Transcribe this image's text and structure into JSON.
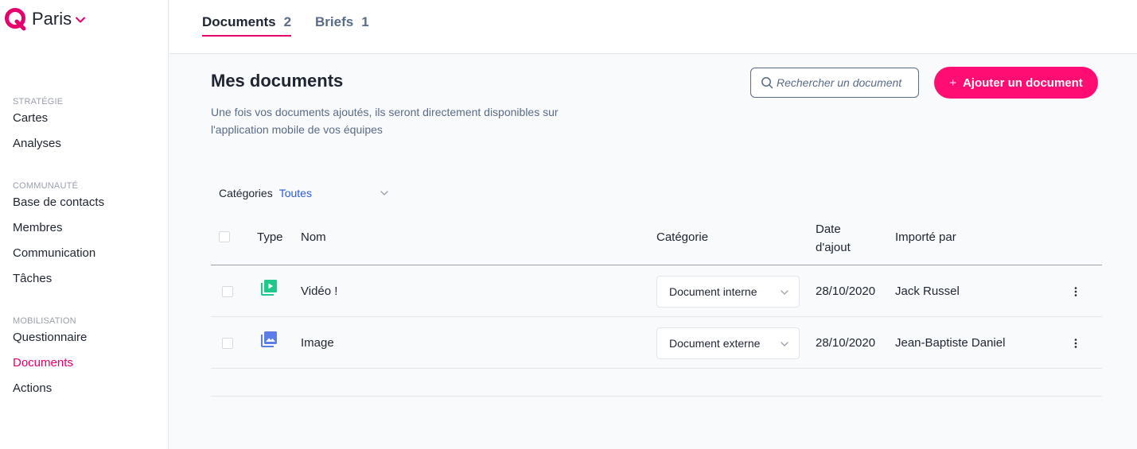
{
  "brand": {
    "name": "Paris",
    "logo_color": "#e5006d"
  },
  "sidebar": {
    "sections": [
      {
        "label": "STRATÉGIE",
        "items": [
          "Cartes",
          "Analyses"
        ]
      },
      {
        "label": "COMMUNAUTÉ",
        "items": [
          "Base de contacts",
          "Membres",
          "Communication",
          "Tâches"
        ]
      },
      {
        "label": "MOBILISATION",
        "items": [
          "Questionnaire",
          "Documents",
          "Actions"
        ]
      }
    ],
    "active_item": "Documents"
  },
  "tabs": [
    {
      "label": "Documents",
      "count": "2",
      "active": true
    },
    {
      "label": "Briefs",
      "count": "1",
      "active": false
    }
  ],
  "main": {
    "title": "Mes documents",
    "description": "Une fois vos documents ajoutés, ils seront directement disponibles sur l'application mobile de vos équipes",
    "search_placeholder": "Rechercher un document",
    "add_button": {
      "icon": "+",
      "label": "Ajouter un document"
    },
    "filter": {
      "label": "Catégories",
      "value": "Toutes"
    }
  },
  "table": {
    "columns": {
      "type": "Type",
      "name": "Nom",
      "category": "Catégorie",
      "date": "Date d'ajout",
      "imported_by": "Importé par"
    },
    "rows": [
      {
        "type_icon": "video-library-icon",
        "icon_color": "#1ec98b",
        "name": "Vidéo !",
        "category": "Document interne",
        "date": "28/10/2020",
        "imported_by": "Jack Russel"
      },
      {
        "type_icon": "image-library-icon",
        "icon_color": "#5b7de8",
        "name": "Image",
        "category": "Document externe",
        "date": "28/10/2020",
        "imported_by": "Jean-Baptiste Daniel"
      }
    ]
  },
  "colors": {
    "accent": "#ff0d73",
    "active_nav": "#e5006d",
    "link": "#2c5bd8",
    "muted": "#5a6b86"
  }
}
